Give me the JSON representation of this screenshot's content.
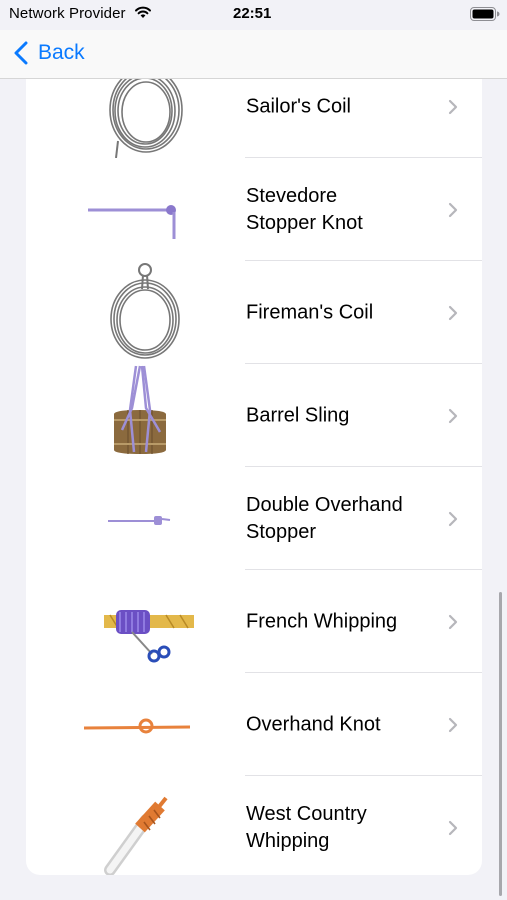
{
  "status_bar": {
    "carrier": "Network Provider",
    "time": "22:51"
  },
  "nav": {
    "back_label": "Back"
  },
  "knots": [
    {
      "name": "Sailor's Coil",
      "icon": "sailors-coil-image"
    },
    {
      "name": "Stevedore\nStopper Knot",
      "icon": "stevedore-stopper-knot-image"
    },
    {
      "name": "Fireman's Coil",
      "icon": "firemans-coil-image"
    },
    {
      "name": "Barrel Sling",
      "icon": "barrel-sling-image"
    },
    {
      "name": "Double Overhand\nStopper",
      "icon": "double-overhand-stopper-image"
    },
    {
      "name": "French Whipping",
      "icon": "french-whipping-image"
    },
    {
      "name": "Overhand Knot",
      "icon": "overhand-knot-image"
    },
    {
      "name": "West Country\nWhipping",
      "icon": "west-country-whipping-image"
    }
  ],
  "colors": {
    "accent": "#0a7aff",
    "rope_purple": "#9d8fd6",
    "rope_orange": "#e8823c",
    "rope_gray": "#7a7a7a"
  }
}
